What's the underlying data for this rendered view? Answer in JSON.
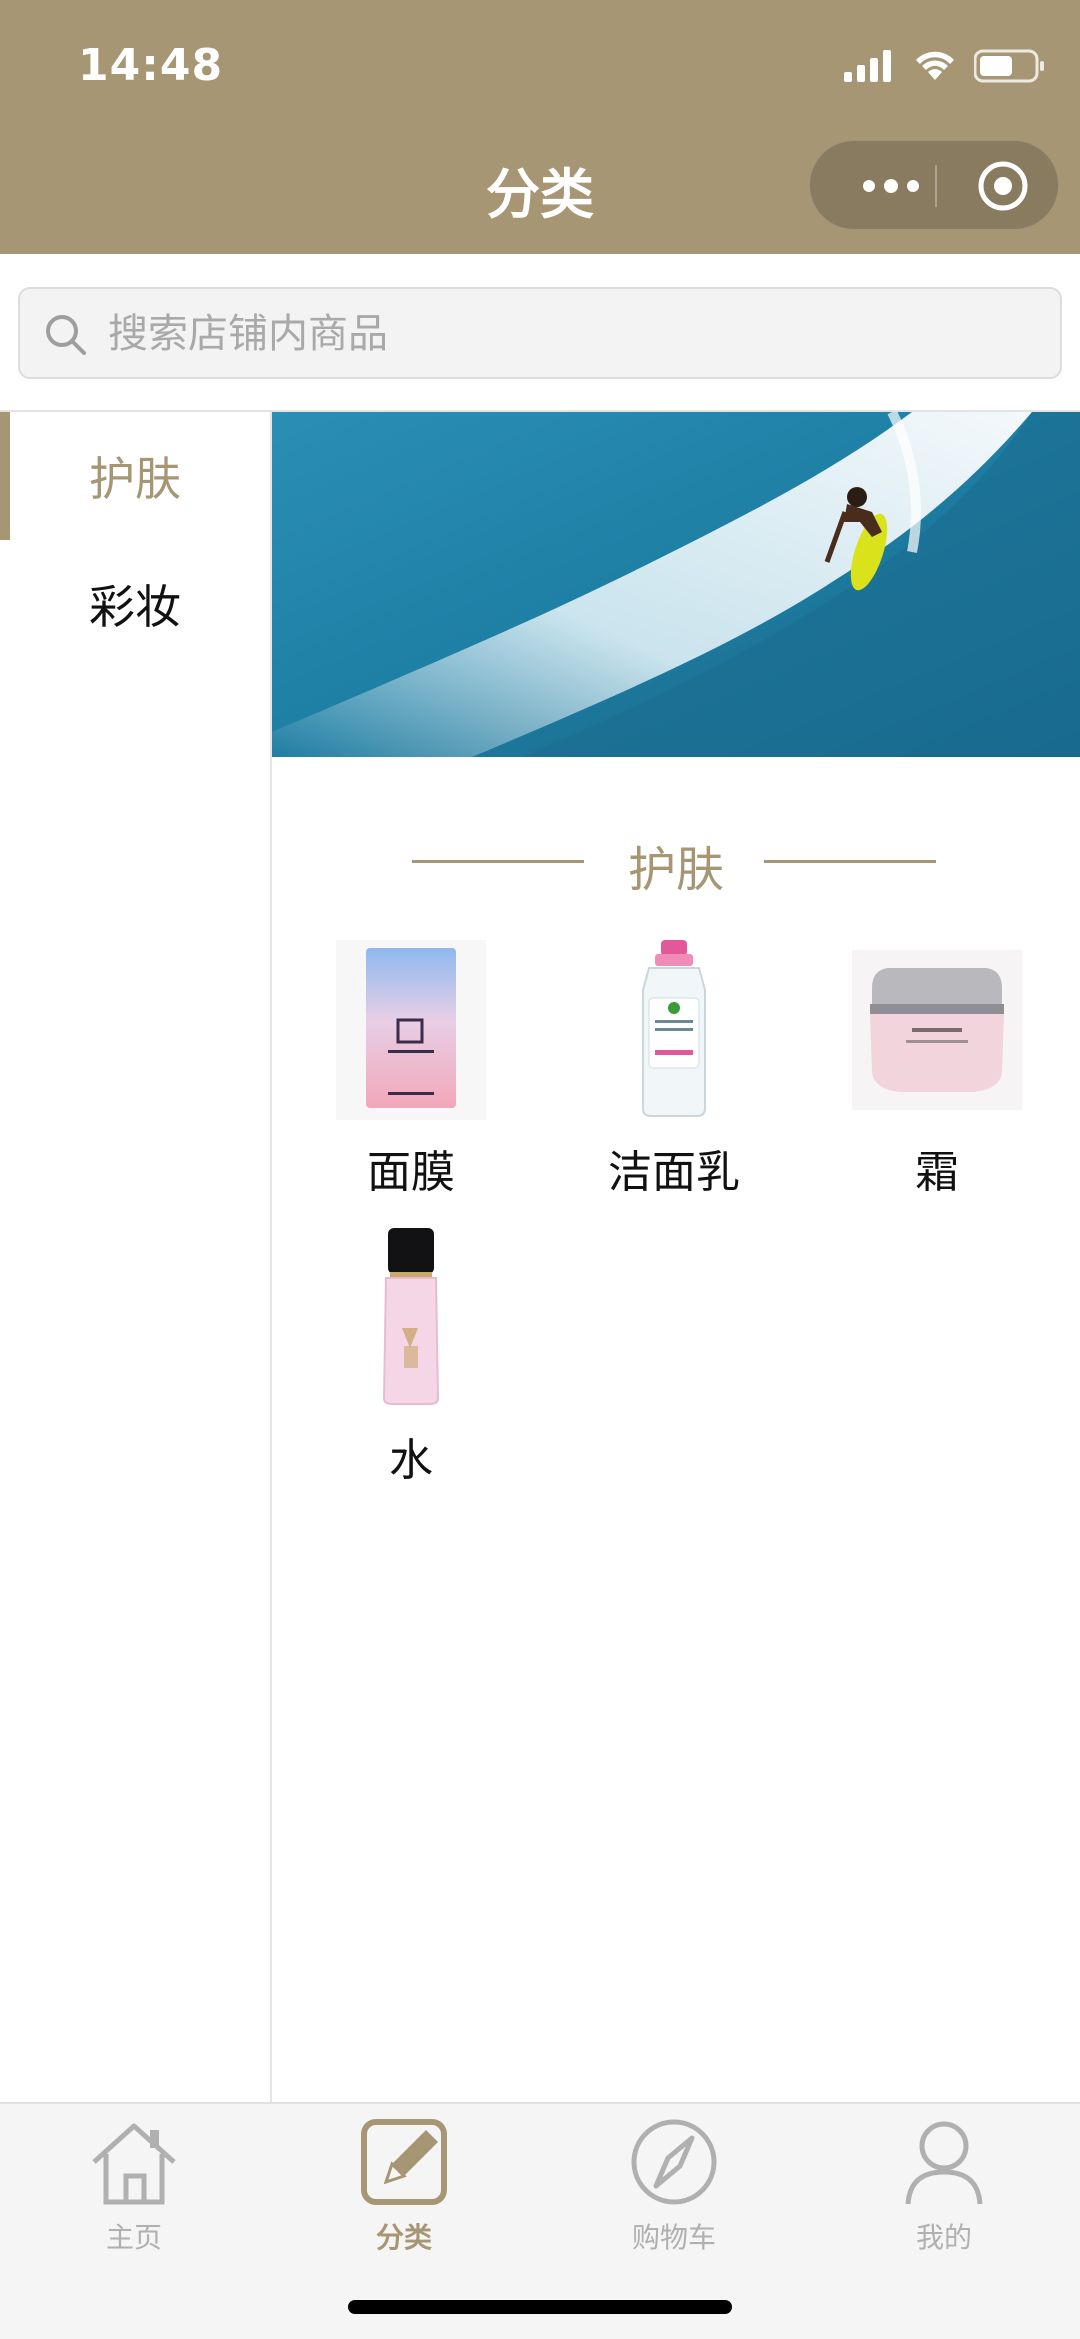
{
  "status_bar": {
    "time": "14:48"
  },
  "header": {
    "title": "分类"
  },
  "search": {
    "placeholder": "搜索店铺内商品"
  },
  "sidebar": {
    "items": [
      {
        "label": "护肤",
        "active": true
      },
      {
        "label": "彩妆",
        "active": false
      }
    ]
  },
  "section": {
    "title": "护肤"
  },
  "categories": [
    {
      "label": "面膜",
      "icon": "face-mask-pack-image"
    },
    {
      "label": "洁面乳",
      "icon": "cleanser-bottle-image"
    },
    {
      "label": "霜",
      "icon": "cream-jar-image"
    },
    {
      "label": "水",
      "icon": "toner-bottle-image"
    }
  ],
  "tabbar": {
    "items": [
      {
        "label": "主页",
        "icon": "home-icon",
        "active": false
      },
      {
        "label": "分类",
        "icon": "category-edit-icon",
        "active": true
      },
      {
        "label": "购物车",
        "icon": "compass-icon",
        "active": false
      },
      {
        "label": "我的",
        "icon": "user-icon",
        "active": false
      }
    ]
  },
  "colors": {
    "accent": "#a79674",
    "header_bg": "#a79674",
    "inactive_tab": "#b0b0b0"
  }
}
